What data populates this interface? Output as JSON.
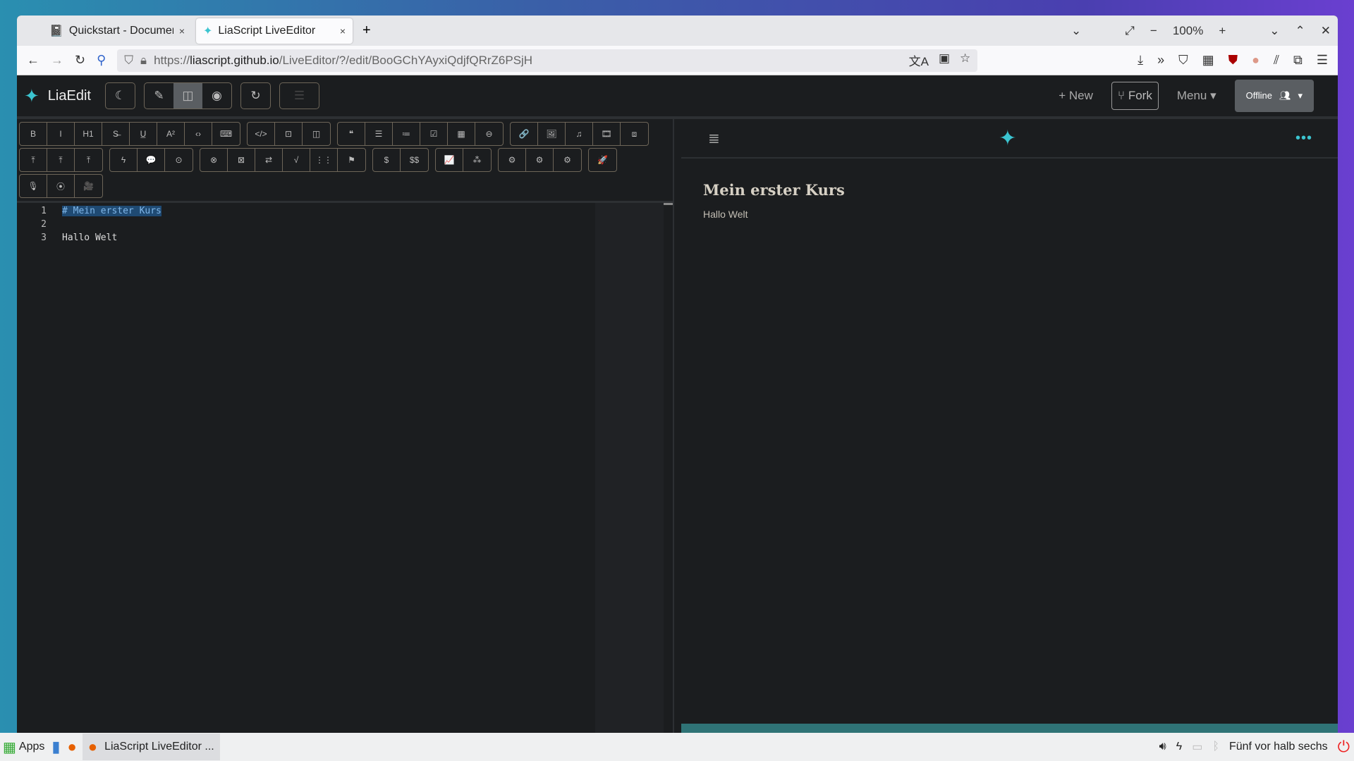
{
  "browser": {
    "tabs": [
      {
        "title": "Quickstart - Documenta",
        "icon": "book-icon"
      },
      {
        "title": "LiaScript LiveEditor",
        "icon": "liascript-icon"
      }
    ],
    "new_tab": "+",
    "zoom": "100%",
    "zoom_out": "−",
    "zoom_in": "+",
    "url_scheme": "https://",
    "url_host": "liascript.github.io",
    "url_path": "/LiveEditor/?/edit/BooGChYAyxiQdjfQRrZ6PSjH"
  },
  "app": {
    "brand": "LiaEdit",
    "new_label": "+ New",
    "fork_label": "Fork",
    "menu_label": "Menu ▾",
    "offline_label": "Offline"
  },
  "toolbar": {
    "rows": [
      [
        [
          {
            "n": "bold",
            "g": "B"
          },
          {
            "n": "italic",
            "g": "I"
          },
          {
            "n": "heading",
            "g": "H1"
          },
          {
            "n": "strikethrough",
            "g": "S̶"
          },
          {
            "n": "underline",
            "g": "U̲"
          },
          {
            "n": "superscript",
            "g": "A²"
          },
          {
            "n": "inline-code",
            "g": "‹›"
          },
          {
            "n": "keyboard",
            "g": "⌨"
          }
        ],
        [
          {
            "n": "code-block",
            "g": "</>"
          },
          {
            "n": "terminal",
            "g": "⊡"
          },
          {
            "n": "split",
            "g": "◫"
          }
        ],
        [
          {
            "n": "quote",
            "g": "❝"
          },
          {
            "n": "bullet-list",
            "g": "☰"
          },
          {
            "n": "numbered-list",
            "g": "≔"
          },
          {
            "n": "checklist",
            "g": "☑"
          },
          {
            "n": "table",
            "g": "▦"
          },
          {
            "n": "horizontal-rule",
            "g": "⊖"
          }
        ],
        [
          {
            "n": "link",
            "g": "🔗"
          },
          {
            "n": "image",
            "g": "🖼"
          },
          {
            "n": "audio",
            "g": "♫"
          },
          {
            "n": "video",
            "g": "🎞"
          },
          {
            "n": "embed",
            "g": "⧈"
          }
        ]
      ],
      [
        [
          {
            "n": "upload-image",
            "g": "⤒"
          },
          {
            "n": "upload-audio",
            "g": "⤒"
          },
          {
            "n": "upload-file",
            "g": "⤒"
          }
        ],
        [
          {
            "n": "effect",
            "g": "ϟ"
          },
          {
            "n": "speech",
            "g": "💬"
          },
          {
            "n": "animation",
            "g": "⊙"
          }
        ],
        [
          {
            "n": "quiz-single",
            "g": "⊗"
          },
          {
            "n": "quiz-multiple",
            "g": "⊠"
          },
          {
            "n": "quiz-select",
            "g": "⇄"
          },
          {
            "n": "quiz-formula",
            "g": "√"
          },
          {
            "n": "quiz-matrix",
            "g": "⋮⋮"
          },
          {
            "n": "quiz-gap",
            "g": "⚑"
          }
        ],
        [
          {
            "n": "math-inline",
            "g": "$"
          },
          {
            "n": "math-block",
            "g": "$$"
          }
        ],
        [
          {
            "n": "chart",
            "g": "📈"
          },
          {
            "n": "diagram",
            "g": "⁂"
          }
        ],
        [
          {
            "n": "script",
            "g": "⚙"
          },
          {
            "n": "script-edit",
            "g": "⚙"
          },
          {
            "n": "script-run",
            "g": "⚙"
          }
        ],
        [
          {
            "n": "deploy",
            "g": "🚀"
          }
        ]
      ],
      [
        [
          {
            "n": "microphone",
            "g": "🎙"
          },
          {
            "n": "webcam",
            "g": "⦿"
          },
          {
            "n": "camera",
            "g": "🎥"
          }
        ]
      ]
    ]
  },
  "editor": {
    "lines": [
      {
        "num": "1",
        "text": "# Mein erster Kurs",
        "selected": true
      },
      {
        "num": "2",
        "text": ""
      },
      {
        "num": "3",
        "text": "Hallo Welt"
      }
    ]
  },
  "preview": {
    "title": "Mein erster Kurs",
    "body": "Hallo Welt"
  },
  "taskbar": {
    "apps_label": "Apps",
    "task_label": "LiaScript LiveEditor ...",
    "clock": "Fünf vor halb sechs"
  },
  "colors": {
    "accent": "#3bc4d0",
    "selection": "#1f4a73",
    "teal_bar": "#2f7376"
  }
}
